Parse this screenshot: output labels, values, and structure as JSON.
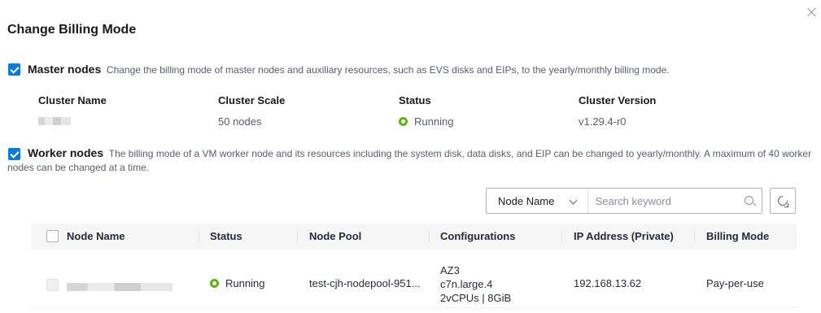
{
  "dialog": {
    "title": "Change Billing Mode",
    "close_icon": "close-icon"
  },
  "master": {
    "checked": true,
    "name": "Master nodes",
    "description": "Change the billing mode of master nodes and auxiliary resources, such as EVS disks and EIPs, to the yearly/monthly billing mode.",
    "columns": {
      "cluster_name": "Cluster Name",
      "cluster_scale": "Cluster Scale",
      "status": "Status",
      "cluster_version": "Cluster Version"
    },
    "values": {
      "cluster_name": "",
      "cluster_scale": "50 nodes",
      "status": "Running",
      "cluster_version": "v1.29.4-r0"
    }
  },
  "worker": {
    "checked": true,
    "name": "Worker nodes",
    "description": "The billing mode of a VM worker node and its resources including the system disk, data disks, and EIP can be changed to yearly/monthly. A maximum of 40 worker nodes can be changed at a time."
  },
  "search": {
    "filter_selected": "Node Name",
    "placeholder": "Search keyword",
    "value": ""
  },
  "table": {
    "headers": {
      "node_name": "Node Name",
      "status": "Status",
      "node_pool": "Node Pool",
      "configurations": "Configurations",
      "ip_address": "IP Address (Private)",
      "billing_mode": "Billing Mode"
    },
    "rows": [
      {
        "node_name": "",
        "status": "Running",
        "node_pool": "test-cjh-nodepool-951...",
        "config_az": "AZ3",
        "config_flavor": "c7n.large.4",
        "config_spec": "2vCPUs | 8GiB",
        "ip_address": "192.168.13.62",
        "billing_mode": "Pay-per-use"
      }
    ]
  },
  "colors": {
    "accent": "#0a7bd8",
    "running": "#5fb014",
    "text": "#252b3a",
    "muted": "#575d6c"
  }
}
